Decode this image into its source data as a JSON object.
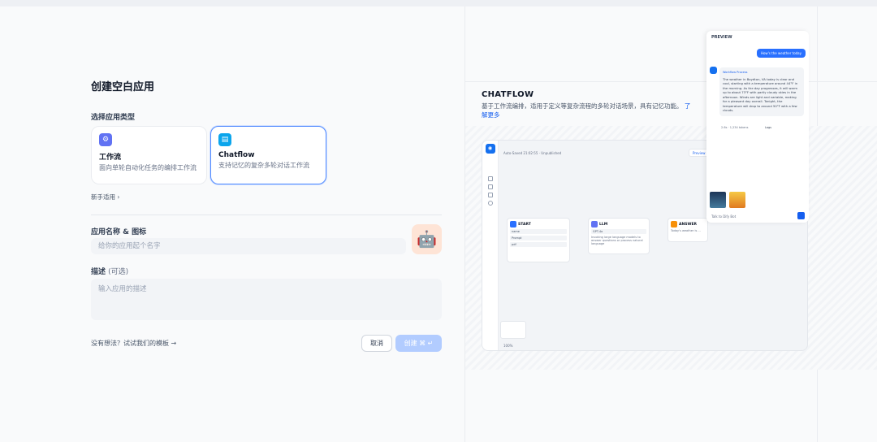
{
  "left": {
    "title": "创建空白应用",
    "type_label": "选择应用类型",
    "cards": [
      {
        "name": "工作流",
        "desc": "面向单轮自动化任务的编排工作流",
        "icon": "workflow-icon",
        "color": "#6172f3"
      },
      {
        "name": "Chatflow",
        "desc": "支持记忆的复杂多轮对话工作流",
        "icon": "chat-icon",
        "color": "#0ba5ec"
      }
    ],
    "beginner": "新手适用",
    "name_label": "应用名称 & 图标",
    "name_placeholder": "给你的应用起个名字",
    "desc_label": "描述",
    "desc_optional": "(可选)",
    "desc_placeholder": "输入应用的描述",
    "tpl_link": "没有想法？试试我们的模板",
    "cancel": "取消",
    "create": "创建"
  },
  "right": {
    "title": "CHATFLOW",
    "desc": "基于工作流编排，适用于定义等复杂流程的多轮对话场景，具有记忆功能。",
    "learn_more": "了解更多",
    "shot": {
      "autosaved": "Auto-Saved 21:02:55 · Unpublished",
      "preview_btn": "Preview",
      "features_btn": "Features",
      "publish_btn": "Publish",
      "nodes": {
        "start": "START",
        "start_rows": [
          "name",
          "Prompt",
          "pdf"
        ],
        "start_foot": "Define the initial parameters for launching a workflow",
        "llm": "LLM",
        "llm_model": "GPT-4o",
        "llm_foot": "Invoking large language models to answer questions or process natural language",
        "answer": "ANSWER",
        "answer_body": "Today's weather is ..."
      },
      "panel": {
        "title": "PREVIEW",
        "user_msg": "How's the weather today",
        "wf_tag": "Workflow Process",
        "bot_msg": "The weather in Boydton, VA today is clear and cool, starting with a temperature around 44°F in the morning. As the day progresses, it will warm up to about 73°F with partly cloudy skies in the afternoon. Winds are light and variable, making for a pleasant day overall. Tonight, the temperature will drop to around 50°F with a few clouds.",
        "meta": "2.6s · 1,234 tokens",
        "input_placeholder": "Talk to Dify Bot",
        "logs": "Logs"
      },
      "zoom": "100%"
    }
  }
}
